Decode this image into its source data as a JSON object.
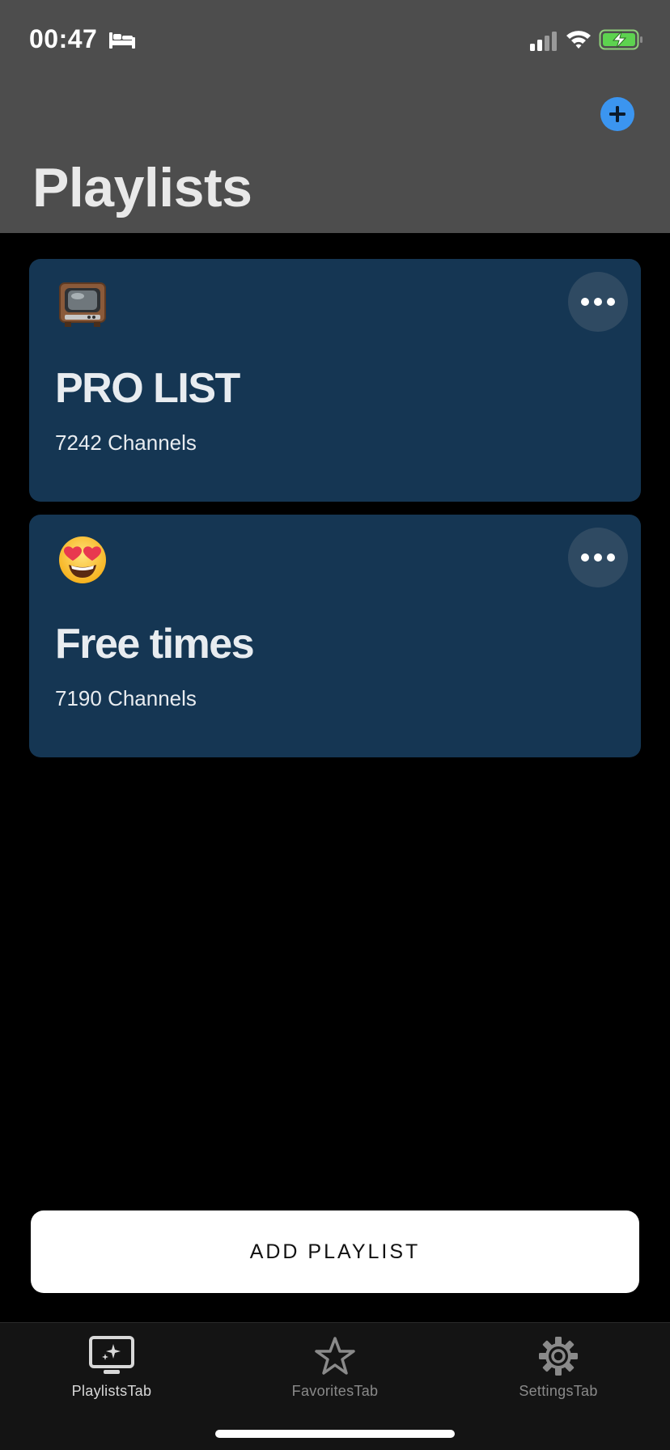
{
  "status_bar": {
    "time": "00:47",
    "icons": [
      "bed-icon",
      "signal-icon",
      "wifi-icon",
      "battery-charging-icon"
    ]
  },
  "header": {
    "title": "Playlists",
    "add_icon": "plus-icon",
    "accent_color": "#3b95f0"
  },
  "playlists": [
    {
      "emoji": "television-emoji",
      "title": "PRO LIST",
      "count": "7242 Channels",
      "more_icon": "ellipsis-icon"
    },
    {
      "emoji": "heart-eyes-emoji",
      "title": "Free times",
      "count": "7190 Channels",
      "more_icon": "ellipsis-icon"
    }
  ],
  "add_playlist_button": {
    "label": "ADD PLAYLIST"
  },
  "tabbar": {
    "tabs": [
      {
        "label": "PlaylistsTab",
        "icon": "tv-sparkle-icon",
        "active": true
      },
      {
        "label": "FavoritesTab",
        "icon": "star-icon",
        "active": false
      },
      {
        "label": "SettingsTab",
        "icon": "gear-icon",
        "active": false
      }
    ]
  },
  "colors": {
    "header_bg": "#4d4d4d",
    "card_bg": "#153653",
    "background": "#000000"
  }
}
